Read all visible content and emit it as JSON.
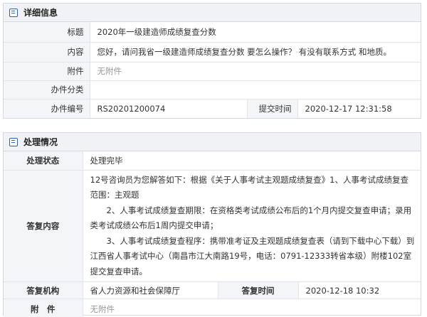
{
  "detail": {
    "title": "详细信息",
    "rows": {
      "subject_label": "标题",
      "subject_value": "2020年一级建造师成绩复查分数",
      "content_label": "内容",
      "content_value": "您好，请问我省一级建造师成绩复查分数 要怎么操作？ 有没有联系方式 和地质。",
      "attachment_label": "附件",
      "attachment_value": "无附件",
      "category_label": "办件分类",
      "category_value": "",
      "number_label": "办件编号",
      "number_value": "RS20201200074",
      "submit_time_label": "提交时间",
      "submit_time_value": "2020-12-17 12:31:58"
    }
  },
  "handling": {
    "title": "处理情况",
    "status_label": "处理状态",
    "status_value": "处理完毕",
    "reply_label": "答复内容",
    "reply_paragraphs": [
      "12号咨询员为您解答如下：根据《关于人事考试主观题成绩复查》1、人事考试成绩复查范围：主观题",
      "　　2、人事考试成绩复查期限：在资格类考试成绩公布后的1个月内提交复查申请；录用类考试成绩公布后1周内提交申请；",
      "　　3、人事考试成绩复查程序：携带准考证及主观题成绩复查表（请到下载中心下载）到江西省人事考试中心（南昌市江大南路19号，电话：0791-12333转省本级）附楼102室提交复查申请。"
    ],
    "org_label": "答复机构",
    "org_value": "省人力资源和社会保障厅",
    "reply_time_label": "答复时间",
    "reply_time_value": "2020-12-18 10:32",
    "attachment_label": "附　件",
    "attachment_value": "无附件"
  },
  "icons": {
    "detail_icon": "list-doc-icon",
    "handling_icon": "list-doc-icon"
  },
  "colors": {
    "icon_blue": "#2f5fa8",
    "label_bg": "#f3f5f8",
    "header_bg": "#f0f2f5",
    "muted_text": "#999999"
  }
}
